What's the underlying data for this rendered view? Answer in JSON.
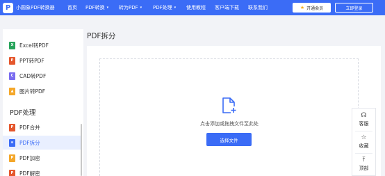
{
  "header": {
    "logo_mark": "P",
    "logo_text": "小圆象PDF转换器",
    "nav": [
      {
        "label": "首页",
        "has_caret": false
      },
      {
        "label": "PDF转换",
        "has_caret": true
      },
      {
        "label": "转为PDF",
        "has_caret": true
      },
      {
        "label": "PDF处理",
        "has_caret": true
      },
      {
        "label": "使用教程",
        "has_caret": false
      },
      {
        "label": "客户端下载",
        "has_caret": false
      },
      {
        "label": "联系我们",
        "has_caret": false
      }
    ],
    "caret": "▾",
    "vip_label": "开通会员",
    "vip_icon": "star-icon",
    "login_label": "立即登录"
  },
  "sidebar": {
    "items_top": [
      {
        "label": "Excel转PDF",
        "icon": "excel-icon",
        "color": "#27a35a",
        "glyph": "X"
      },
      {
        "label": "PPT转PDF",
        "icon": "ppt-icon",
        "color": "#e5572d",
        "glyph": "P"
      },
      {
        "label": "CAD转PDF",
        "icon": "cad-icon",
        "color": "#7a6cf0",
        "glyph": "C"
      },
      {
        "label": "图片转PDF",
        "icon": "image-icon",
        "color": "#f4a72a",
        "glyph": "▲"
      }
    ],
    "section_title": "PDF处理",
    "items_section": [
      {
        "label": "PDF合并",
        "icon": "merge-icon",
        "color": "#e5572d",
        "glyph": "P",
        "active": false
      },
      {
        "label": "PDF拆分",
        "icon": "split-icon",
        "color": "#3b6cf6",
        "glyph": "≡",
        "active": true
      },
      {
        "label": "PDF加密",
        "icon": "encrypt-icon",
        "color": "#f4a72a",
        "glyph": "P",
        "active": false
      },
      {
        "label": "PDF解密",
        "icon": "decrypt-icon",
        "color": "#e5572d",
        "glyph": "P",
        "active": false
      }
    ]
  },
  "main": {
    "title": "PDF拆分",
    "drop_text": "点击添加或拖拽文件至此处",
    "choose_label": "选择文件"
  },
  "float_bar": [
    {
      "label": "客服",
      "icon": "headset-icon",
      "glyph": "☊"
    },
    {
      "label": "收藏",
      "icon": "star-outline-icon",
      "glyph": "☆"
    },
    {
      "label": "顶部",
      "icon": "back-to-top-icon",
      "glyph": "⤒"
    }
  ],
  "colors": {
    "accent": "#3b6cf6",
    "active_bg": "#e9efff"
  }
}
